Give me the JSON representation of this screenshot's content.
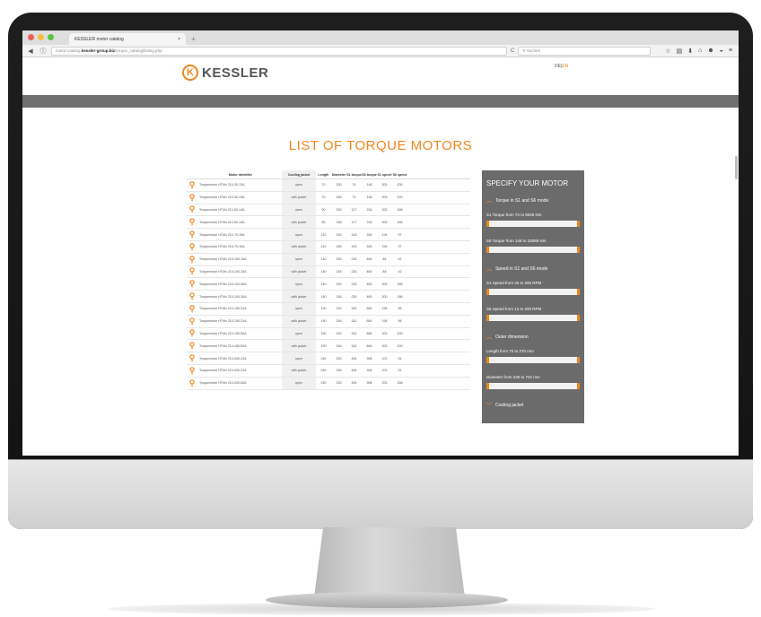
{
  "browser": {
    "tab_title": "KESSLER motor catalog",
    "tab_close": "×",
    "new_tab": "+",
    "url_prefix": "motor-catalog.",
    "url_domain": "kessler-group.biz",
    "url_path": "/torque_catalog/listing.php",
    "reload_glyph": "C",
    "search_placeholder": "Suchen"
  },
  "page": {
    "lang_de": "DE",
    "lang_sep": "|",
    "lang_en": "EN",
    "logo_mark": "K",
    "logo_text": "KESSLER",
    "title": "LIST OF TORQUE MOTORS"
  },
  "table": {
    "headers": [
      "Motor identifier",
      "Cooling jacket",
      "Length",
      "Diameter",
      "S1 torque",
      "S6 torque",
      "S1 speed",
      "S6 speed"
    ],
    "rows": [
      [
        "Torquemotor HTMx 210-30-13A",
        "open",
        "70",
        "230",
        "74",
        "148",
        "200",
        "200"
      ],
      [
        "Torquemotor HTMx 210-30-13A",
        "with jacket",
        "70",
        "248",
        "74",
        "148",
        "200",
        "200"
      ],
      [
        "Torquemotor HTMx 210-50-14A",
        "open",
        "90",
        "230",
        "117",
        "234",
        "200",
        "166"
      ],
      [
        "Torquemotor HTMx 210-50-14A",
        "with jacket",
        "90",
        "248",
        "117",
        "234",
        "200",
        "166"
      ],
      [
        "Torquemotor HTMx 210-70-15A",
        "open",
        "110",
        "230",
        "163",
        "326",
        "194",
        "97"
      ],
      [
        "Torquemotor HTMx 210-70-15A",
        "with jacket",
        "110",
        "248",
        "163",
        "326",
        "194",
        "97"
      ],
      [
        "Torquemotor HTMx 210-100-15A",
        "open",
        "140",
        "230",
        "230",
        "460",
        "84",
        "42"
      ],
      [
        "Torquemotor HTMx 210-100-15A",
        "with jacket",
        "140",
        "248",
        "230",
        "460",
        "84",
        "42"
      ],
      [
        "Torquemotor HTMx 210-100-30A",
        "open",
        "140",
        "230",
        "230",
        "460",
        "200",
        "186"
      ],
      [
        "Torquemotor HTMx 210-100-30A",
        "with jacket",
        "140",
        "248",
        "230",
        "460",
        "200",
        "186"
      ],
      [
        "Torquemotor HTMx 210-150-31A",
        "open",
        "190",
        "230",
        "342",
        "684",
        "196",
        "98"
      ],
      [
        "Torquemotor HTMx 210-150-31A",
        "with jacket",
        "190",
        "248",
        "342",
        "684",
        "196",
        "98"
      ],
      [
        "Torquemotor HTMx 210-150-50A",
        "open",
        "190",
        "230",
        "342",
        "684",
        "200",
        "200"
      ],
      [
        "Torquemotor HTMx 210-150-50A",
        "with jacket",
        "190",
        "248",
        "342",
        "684",
        "200",
        "200"
      ],
      [
        "Torquemotor HTMx 210-200-31A",
        "open",
        "240",
        "230",
        "454",
        "908",
        "102",
        "51"
      ],
      [
        "Torquemotor HTMx 210-200-31A",
        "with jacket",
        "240",
        "248",
        "454",
        "908",
        "102",
        "51"
      ],
      [
        "Torquemotor HTMx 210-200-50A",
        "open",
        "240",
        "230",
        "454",
        "908",
        "200",
        "156"
      ]
    ]
  },
  "sidebar": {
    "title": "SPECIFY YOUR MOTOR",
    "section_torque": "Torque in S1 and S6 mode",
    "s1_torque": "S1 Torque from 74 to 9045 Nm",
    "s6_torque": "S6 Torque from 148 to 18089 Nm",
    "section_speed": "Speed in S1 and S6 mode",
    "s1_speed": "S1 Speed from 26 to 200 RPM",
    "s6_speed": "S6 Speed from 13 to 200 RPM",
    "section_outer": "Outer dimension",
    "length": "Length from 70 to 270 mm",
    "diameter": "Diameter from 230 to 722 mm",
    "section_cooling": "Cooling jacket"
  },
  "colors": {
    "accent": "#f0861e",
    "sidebar_bg": "#6b6b6b",
    "greybar": "#707070"
  }
}
